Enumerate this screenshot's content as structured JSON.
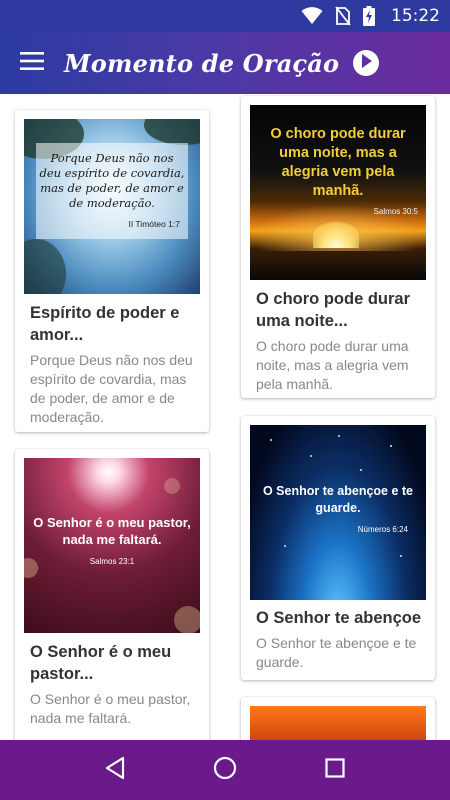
{
  "status_bar": {
    "time": "15:22"
  },
  "app_bar": {
    "title": "Momento de Oração"
  },
  "cards": [
    {
      "title": "Espírito de poder e amor...",
      "text": "Porque Deus não nos deu espírito de covardia, mas de poder, de amor e de moderação.",
      "image_quote": "Porque Deus não nos deu espírito de covardia, mas de poder, de amor e de moderação.",
      "image_ref": "II Timóteo 1:7"
    },
    {
      "title": "O choro pode durar uma noite...",
      "text": "O choro pode durar uma noite, mas a alegria vem pela manhã.",
      "image_quote": "O choro pode durar uma noite, mas a alegria vem pela manhã.",
      "image_ref": "Salmos 30:5"
    },
    {
      "title": "O Senhor é o meu pastor...",
      "text": "O Senhor é o meu pastor, nada me faltará.",
      "image_quote": "O Senhor é o meu pastor, nada me faltará.",
      "image_ref": "Salmos 23:1"
    },
    {
      "title": "O Senhor te abençoe",
      "text": "O Senhor te abençoe e te guarde.",
      "image_quote": "O Senhor te abençoe e te guarde.",
      "image_ref": "Números 6:24"
    }
  ],
  "colors": {
    "status_bar": "#2f3aa0",
    "app_bar_start": "#2c3ba2",
    "app_bar_end": "#6a2b9e",
    "nav_bar": "#6a1a8a"
  },
  "icons": {
    "menu": "hamburger-menu-icon",
    "play": "play-circle-icon",
    "back": "triangle-back-icon",
    "home": "circle-home-icon",
    "recents": "square-recents-icon"
  }
}
